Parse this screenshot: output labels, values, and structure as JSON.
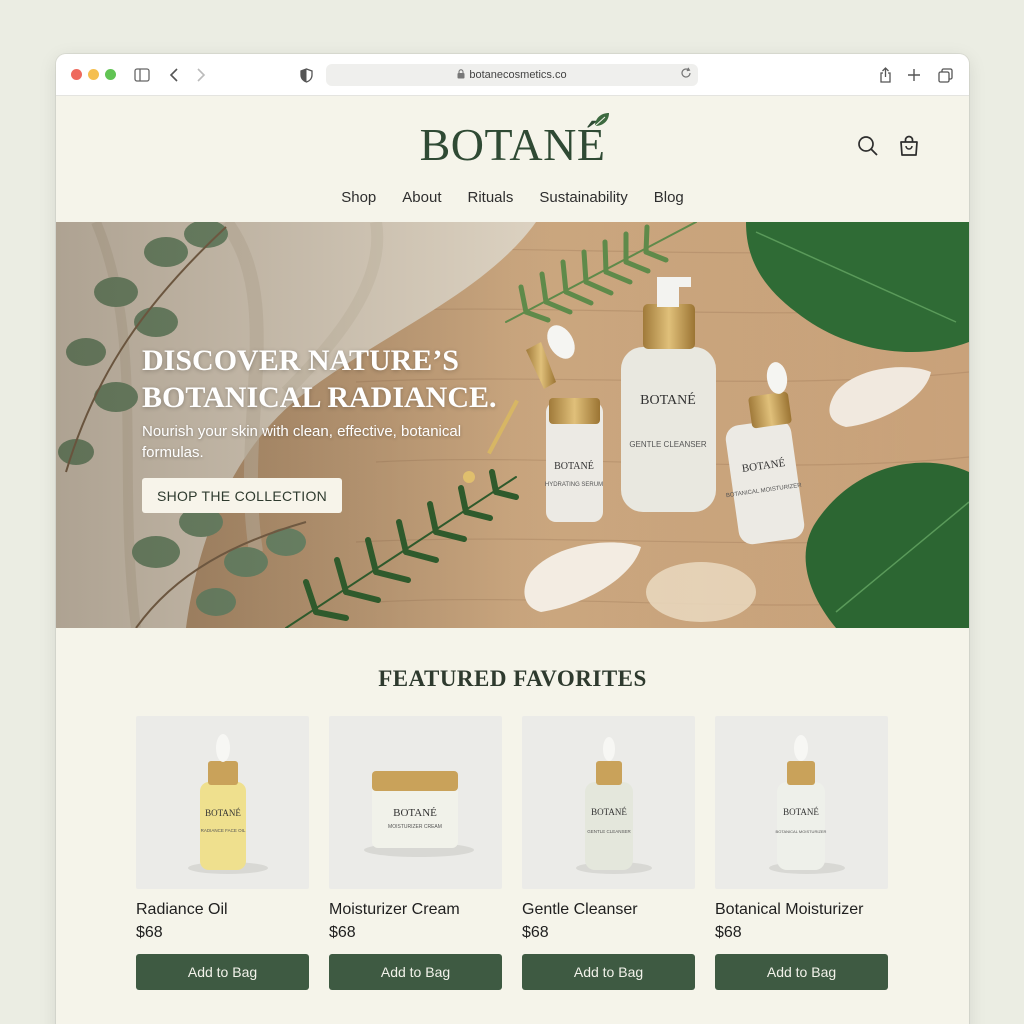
{
  "browser": {
    "url": "botanecosmetics.co"
  },
  "header": {
    "logo": "BOTANÉ",
    "nav": [
      "Shop",
      "About",
      "Rituals",
      "Sustainability",
      "Blog"
    ]
  },
  "hero": {
    "title_line1": "DISCOVER NATURE’S",
    "title_line2": "BOTANICAL RADIANCE.",
    "subtitle": "Nourish your skin with clean, effective, botanical formulas.",
    "cta": "SHOP THE COLLECTION",
    "product_labels": {
      "brand": "BOTANÉ",
      "serum": "HYDRATING SERUM",
      "cleanser": "GENTLE CLEANSER",
      "moisturizer": "BOTANICAL MOISTURIZER"
    }
  },
  "featured": {
    "title": "FEATURED FAVORITES",
    "products": [
      {
        "name": "Radiance Oil",
        "price": "$68",
        "button": "Add to Bag",
        "label_brand": "BOTANÉ",
        "label_text": "RADIANCE FACE OIL",
        "bottle_color": "#efe08e"
      },
      {
        "name": "Moisturizer Cream",
        "price": "$68",
        "button": "Add to Bag",
        "label_brand": "BOTANÉ",
        "label_text": "MOISTURIZER CREAM",
        "bottle_color": "#f1f2ea"
      },
      {
        "name": "Gentle Cleanser",
        "price": "$68",
        "button": "Add to Bag",
        "label_brand": "BOTANÉ",
        "label_text": "GENTLE CLEANSER",
        "bottle_color": "#e4e7dc"
      },
      {
        "name": "Botanical Moisturizer",
        "price": "$68",
        "button": "Add to Bag",
        "label_brand": "BOTANÉ",
        "label_text": "BOTANICAL MOISTURIZER",
        "bottle_color": "#eef0ea"
      }
    ]
  },
  "colors": {
    "brand_green": "#2f4a34",
    "button_green": "#3e5a42",
    "page_bg": "#f5f4ea"
  }
}
